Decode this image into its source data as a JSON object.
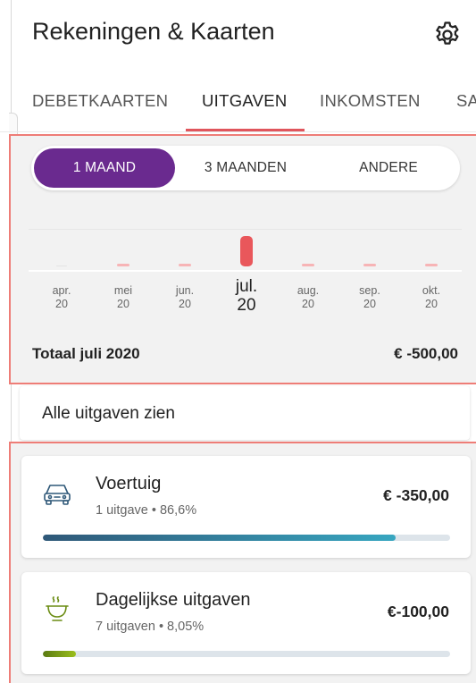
{
  "header": {
    "title": "Rekeningen & Kaarten",
    "settings_icon": "gear-icon"
  },
  "tabs": [
    {
      "label": "DEBETKAARTEN",
      "active": false
    },
    {
      "label": "UITGAVEN",
      "active": true
    },
    {
      "label": "INKOMSTEN",
      "active": false
    },
    {
      "label": "SA",
      "active": false
    }
  ],
  "period_selector": {
    "options": [
      "1 MAAND",
      "3 MAANDEN",
      "ANDERE"
    ],
    "selected": "1 MAAND",
    "accent": "#6a2a8f"
  },
  "chart_data": {
    "type": "bar",
    "categories": [
      "apr. 20",
      "mei 20",
      "jun. 20",
      "jul. 20",
      "aug. 20",
      "sep. 20",
      "okt. 20"
    ],
    "month_labels": [
      {
        "month": "apr.",
        "year": "20"
      },
      {
        "month": "mei",
        "year": "20"
      },
      {
        "month": "jun.",
        "year": "20"
      },
      {
        "month": "jul.",
        "year": "20"
      },
      {
        "month": "aug.",
        "year": "20"
      },
      {
        "month": "sep.",
        "year": "20"
      },
      {
        "month": "okt.",
        "year": "20"
      }
    ],
    "values": [
      0,
      5,
      5,
      500,
      5,
      5,
      5
    ],
    "selected_index": 3,
    "bar_color": "#f7b4b6",
    "active_bar_color": "#e9575b"
  },
  "summary": {
    "label": "Totaal juli 2020",
    "value": "€ -500,00"
  },
  "all_expenses": {
    "label": "Alle uitgaven zien"
  },
  "categories": [
    {
      "name": "Voertuig",
      "sub": "1 uitgave • 86,6%",
      "amount": "€ -350,00",
      "icon": "car-icon",
      "progress": 0.866,
      "color_from": "#2f5878",
      "color_to": "#37a6c0"
    },
    {
      "name": "Dagelijkse uitgaven",
      "sub": "7 uitgaven • 8,05%",
      "amount": "€-100,00",
      "icon": "food-bowl-icon",
      "progress": 0.0805,
      "color_from": "#5a7a12",
      "color_to": "#9bbf1c"
    }
  ]
}
